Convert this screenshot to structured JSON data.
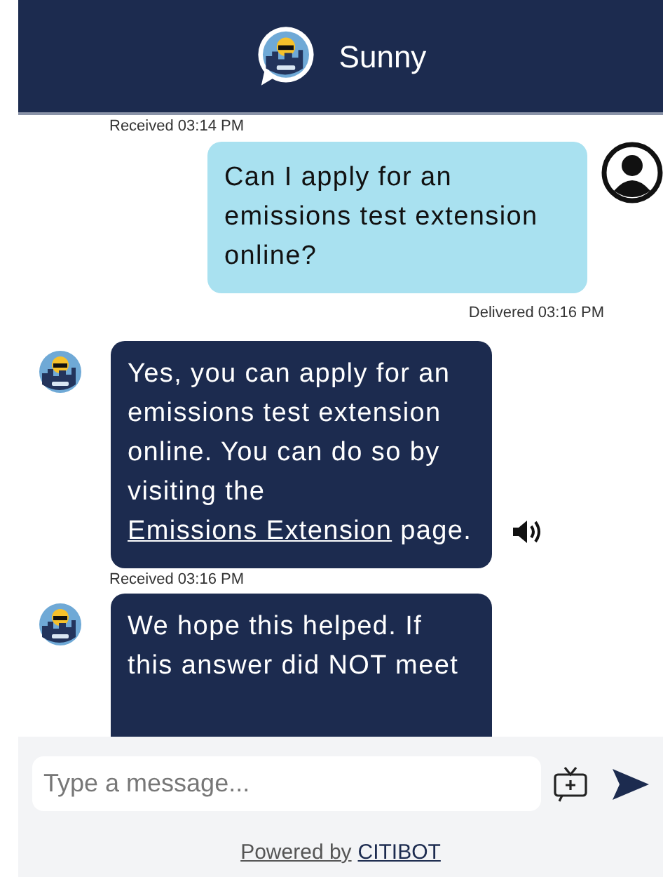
{
  "header": {
    "title": "Sunny"
  },
  "feed": [
    {
      "kind": "timestamp",
      "text": "Received 03:14 PM"
    },
    {
      "kind": "user",
      "text": "Can I apply for an emissions test extension online?"
    },
    {
      "kind": "delivered",
      "text": "Delivered 03:16 PM"
    },
    {
      "kind": "bot",
      "text": "Yes, you can apply for an emissions test extension online. You can do so by visiting the ",
      "link": "Emissions Extension",
      "after": " page.",
      "speaker": true
    },
    {
      "kind": "timestamp",
      "text": "Received 03:16 PM"
    },
    {
      "kind": "bot",
      "text": "We hope this helped. If this answer did NOT meet"
    }
  ],
  "composer": {
    "placeholder": "Type a message..."
  },
  "footer": {
    "text": "Powered by",
    "link": "CITIBOT"
  }
}
